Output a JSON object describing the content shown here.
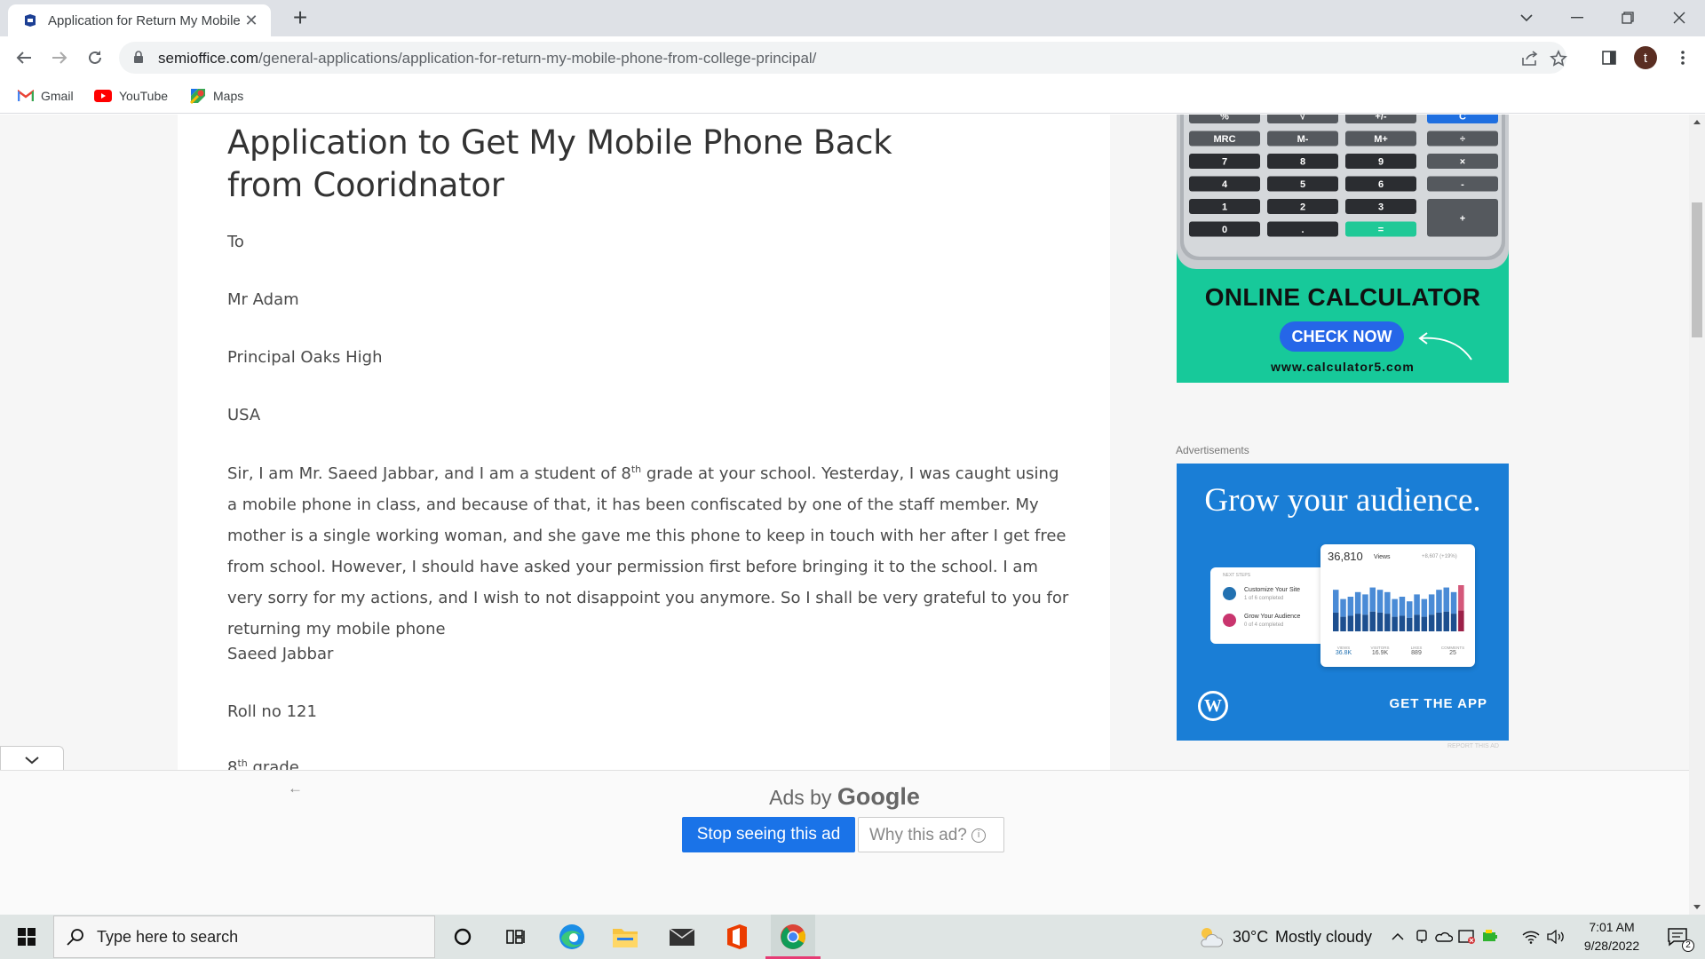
{
  "browser": {
    "tab_title": "Application for Return My Mobile Phone from College Principal",
    "url_host": "semioffice.com",
    "url_path": "/general-applications/application-for-return-my-mobile-phone-from-college-principal/",
    "profile_initial": "t"
  },
  "bookmarks": [
    {
      "label": "Gmail",
      "icon": "gmail-icon"
    },
    {
      "label": "YouTube",
      "icon": "youtube-icon"
    },
    {
      "label": "Maps",
      "icon": "maps-icon"
    }
  ],
  "article": {
    "title": "Application to Get My Mobile Phone Back from Cooridnator",
    "lines": [
      "To",
      "Mr Adam",
      "Principal Oaks High",
      "USA"
    ],
    "body_prefix": "Sir, I am Mr. Saeed Jabbar, and I am a student of 8",
    "body_sup": "th",
    "body_rest": " grade at your school. Yesterday, I was caught using a mobile phone in class, and because of that, it has been confiscated by one of the staff member. My mother is a single working woman, and she gave me this phone to keep in touch with her after I get free from school. However, I should have asked your permission first before bringing it to the school. I am very sorry for my actions, and I wish to not disappoint you anymore. So I shall be very grateful to you for returning my mobile phone",
    "signature": "Saeed Jabbar",
    "roll": "Roll no 121",
    "grade_num": "8",
    "grade_sup": "th",
    "grade_word": " grade"
  },
  "calc_ad": {
    "headline": "ONLINE CALCULATOR",
    "cta": "CHECK NOW",
    "site": "www.calculator5.com",
    "keys": [
      [
        "%",
        "√",
        "+/-",
        "C"
      ],
      [
        "MRC",
        "M-",
        "M+",
        "÷"
      ],
      [
        "7",
        "8",
        "9",
        "×"
      ],
      [
        "4",
        "5",
        "6",
        "-"
      ],
      [
        "1",
        "2",
        "3",
        "+"
      ],
      [
        "0",
        ".",
        "="
      ]
    ]
  },
  "sidebar": {
    "ads_label": "Advertisements",
    "report_label": "REPORT THIS AD"
  },
  "wp_ad": {
    "headline": "Grow your audience.",
    "views_count": "36,810",
    "views_label": "Views",
    "views_delta": "+8,607 (+19%)",
    "next_steps": "NEXT STEPS",
    "step1_title": "Customize Your Site",
    "step1_sub": "1 of 6 completed",
    "step2_title": "Grow Your Audience",
    "step2_sub": "0 of 4 completed",
    "stats": [
      {
        "label": "VIEWS",
        "value": "36.8K"
      },
      {
        "label": "VISITORS",
        "value": "16.9K"
      },
      {
        "label": "LIKES",
        "value": "889"
      },
      {
        "label": "COMMENTS",
        "value": "25"
      }
    ],
    "cta": "GET THE APP",
    "bar_values": [
      0.9,
      0.7,
      0.75,
      0.85,
      0.8,
      0.95,
      0.9,
      0.85,
      0.7,
      0.75,
      0.65,
      0.8,
      0.7,
      0.8,
      0.9,
      0.95,
      0.85,
      1.0
    ]
  },
  "anchor_ad": {
    "ads_by": "Ads by",
    "google": "Google",
    "stop": "Stop seeing this ad",
    "why": "Why this ad?"
  },
  "taskbar": {
    "search_placeholder": "Type here to search",
    "weather_temp": "30°C",
    "weather_desc": "Mostly cloudy",
    "time": "7:01 AM",
    "date": "9/28/2022",
    "notification_count": "2"
  },
  "colors": {
    "calc_green": "#17c99a",
    "wp_blue": "#1a7ed6",
    "google_blue": "#1a73e8",
    "taskbar": "#dfe5e4"
  }
}
